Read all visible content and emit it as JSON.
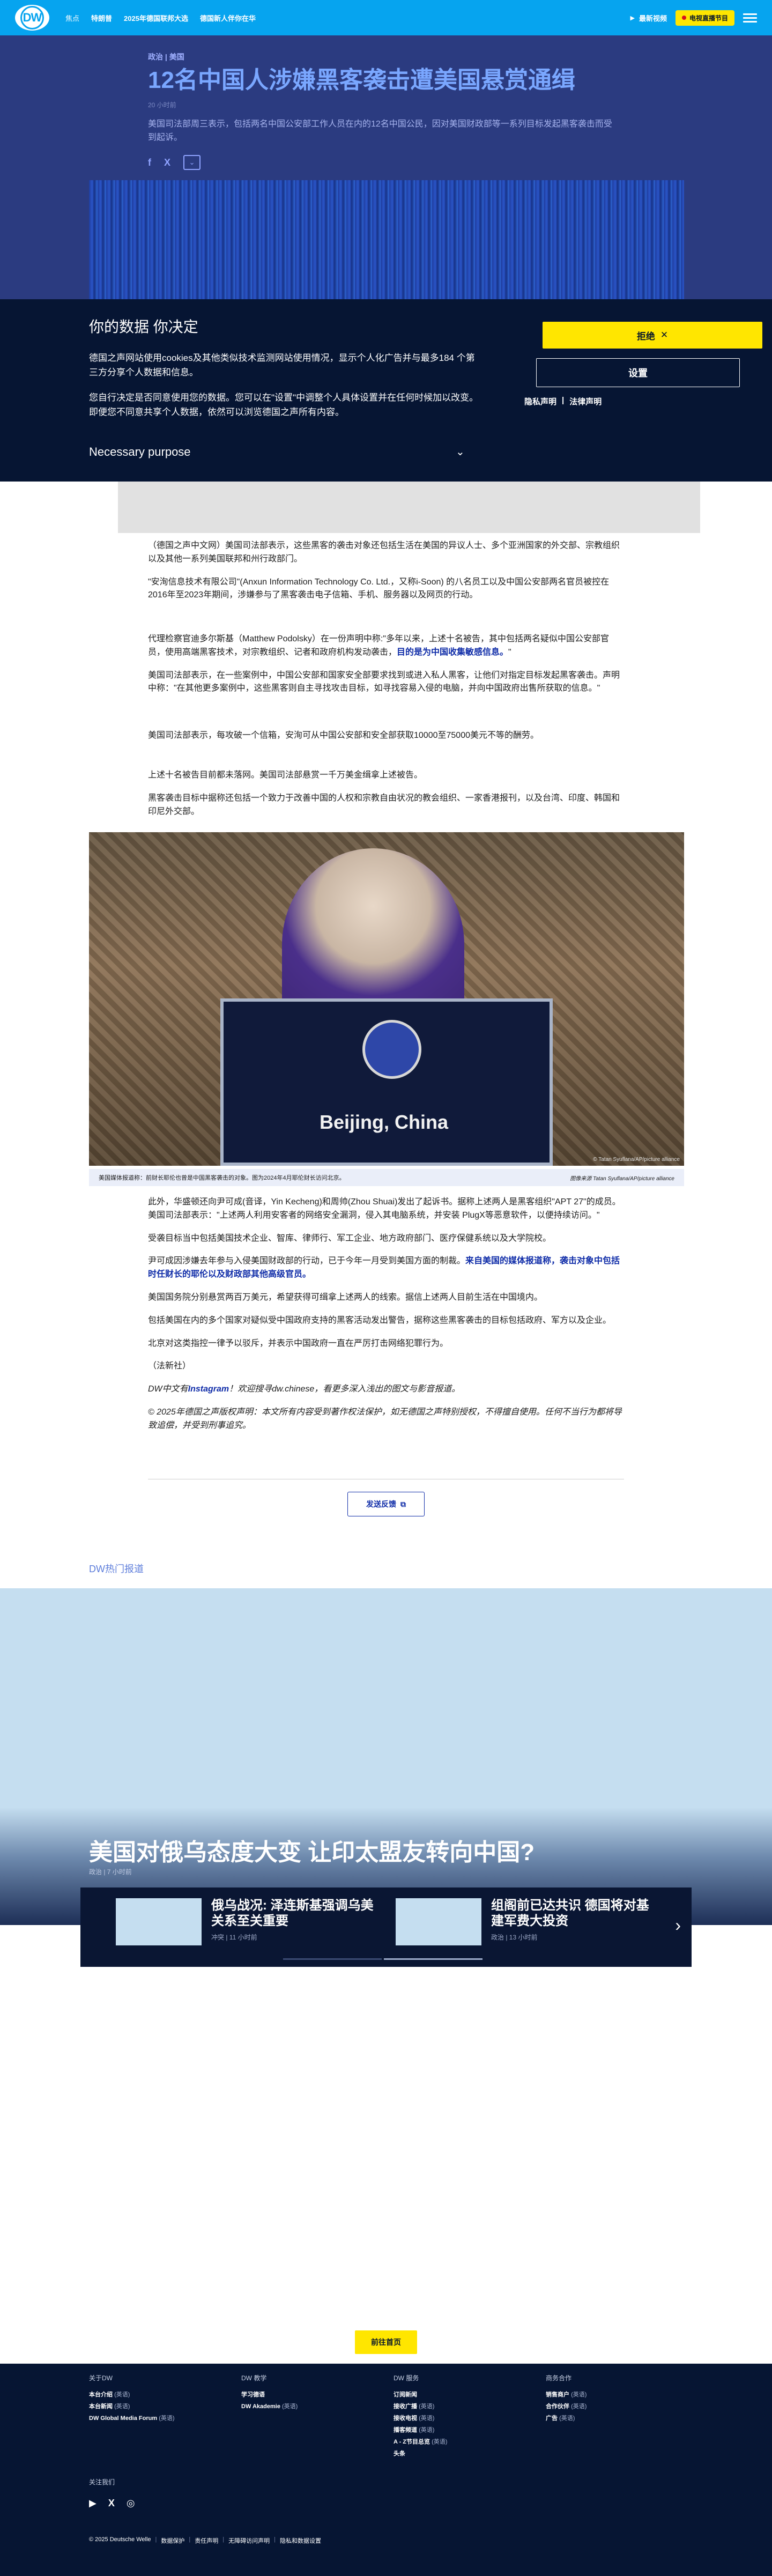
{
  "header": {
    "logo": "DW",
    "nav": [
      "焦点",
      "特朗普",
      "2025年德国联邦大选",
      "德国新人伴你在华"
    ],
    "latest_label": "最新视频",
    "live_label": "电视直播节目"
  },
  "article": {
    "breadcrumb": "政治 | 美国",
    "title": "12名中国人涉嫌黑客袭击遭美国悬赏通缉",
    "time_ago": "20 小时前",
    "teaser": "美国司法部周三表示，包括两名中国公安部工作人员在内的12名中国公民，因对美国财政部等一系列目标发起黑客袭击而受到起诉。",
    "share_icons": [
      "f",
      "X"
    ],
    "paragraphs_a": [
      "（德国之声中文网）美国司法部表示，这些黑客的袭击对象还包括生活在美国的异议人士、多个亚洲国家的外交部、宗教组织以及其他一系列美国联邦和州行政部门。",
      "\"安洵信息技术有限公司\"(Anxun Information Technology Co. Ltd.，又称i-Soon) 的八名员工以及中国公安部两名官员被控在2016年至2023年期间，涉嫌参与了黑客袭击电子信箱、手机、服务器以及网页的行动。"
    ],
    "paragraph_b_text": "代理检察官迪多尔斯基（Matthew Podolsky）在一份声明中称:\"多年以来，上述十名被告，其中包括两名疑似中国公安部官员，使用高端黑客技术，对宗教组织、记者和政府机构发动袭击，",
    "paragraph_b_link": "目的是为中国收集敏感信息。",
    "paragraph_b_end": "\"",
    "paragraph_b2": "美国司法部表示，在一些案例中，中国公安部和国家安全部要求找到或进入私人黑客，让他们对指定目标发起黑客袭击。声明中称：\"在其他更多案例中，这些黑客则自主寻找攻击目标，如寻找容易入侵的电脑，并向中国政府出售所获取的信息。\"",
    "paragraph_c": "美国司法部表示，每攻破一个信箱，安洵可从中国公安部和安全部获取10000至75000美元不等的酬劳。",
    "paragraphs_d": [
      "上述十名被告目前都未落网。美国司法部悬赏一千万美金缉拿上述被告。",
      "黑客袭击目标中据称还包括一个致力于改善中国的人权和宗教自由状况的教会组织、一家香港报刊，以及台湾、印度、韩国和印尼外交部。"
    ],
    "photo_plate": "Beijing, China",
    "photo_credit": "© Tatan Syuflana/AP/picture alliance",
    "caption": "美国媒体报道称：前财长耶伦也曾是中国黑客袭击的对象。图为2024年4月耶伦财长访问北京。",
    "caption_credit": "图像来源 Tatan Syuflana/AP/picture alliance",
    "paragraphs_e": [
      "此外，华盛顿还向尹可成(音译，Yin Kecheng)和周帅(Zhou Shuai)发出了起诉书。据称上述两人是黑客组织\"APT 27\"的成员。美国司法部表示：\"上述两人利用安客者的网络安全漏洞，侵入其电脑系统，并安装 PlugX等恶意软件，以便持续访问。\"",
      "受袭目标当中包括美国技术企业、智库、律师行、军工企业、地方政府部门、医疗保健系统以及大学院校。"
    ],
    "paragraph_f_text": "尹可成因涉嫌去年参与入侵美国财政部的行动，已于今年一月受到美国方面的制裁。",
    "paragraph_f_link": "来自美国的媒体报道称，袭击对象中包括时任财长的耶伦以及财政部其他高级官员。",
    "paragraphs_g": [
      "美国国务院分别悬赏两百万美元，希望获得可缉拿上述两人的线索。据信上述两人目前生活在中国境内。",
      "包括美国在内的多个国家对疑似受中国政府支持的黑客活动发出警告，据称这些黑客袭击的目标包括政府、军方以及企业。",
      "北京对这类指控一律予以驳斥，并表示中国政府一直在严厉打击网络犯罪行为。",
      "（法新社）"
    ],
    "instagram_pre": "DW中文有",
    "instagram_link": "Instagram",
    "instagram_post": "！欢迎搜寻dw.chinese，看更多深入浅出的图文与影音报道。",
    "copyright": "© 2025年德国之声版权声明：本文所有内容受到著作权法保护，如无德国之声特别授权，不得擅自使用。任何不当行为都将导致追偿，并受到刑事追究。",
    "feedback_label": "发送反馈"
  },
  "cookie": {
    "title": "你的数据 你决定",
    "text1": "德国之声网站使用cookies及其他类似技术监测网站使用情况，显示个人化广告并与最多184 个第三方分享个人数据和信息。",
    "text2": "您自行决定是否同意使用您的数据。您可以在\"设置\"中调整个人具体设置并在任何时候加以改变。即便您不同意共享个人数据，依然可以浏览德国之声所有内容。",
    "reject_label": "拒绝",
    "settings_label": "设置",
    "privacy_link": "隐私声明",
    "legal_link": "法律声明",
    "purpose_label": "Necessary purpose"
  },
  "hot": {
    "label": "DW热门报道",
    "title": "美国对俄乌态度大变 让印太盟友转向中国?",
    "meta": "政治 | 7 小时前",
    "cards": [
      {
        "title": "俄乌战况: 泽连斯基强调乌美关系至关重要",
        "meta": "冲突 | 11 小时前"
      },
      {
        "title": "组阁前已达共识 德国将对基建军费大投资",
        "meta": "政治 | 13 小时前"
      }
    ]
  },
  "cta_label": "前往首页",
  "footer": {
    "col1_title": "关于DW",
    "col1_links": [
      [
        "本台介绍",
        "(英语)"
      ],
      [
        "本台新闻",
        "(英语)"
      ],
      [
        "DW Global Media Forum",
        "(英语)"
      ]
    ],
    "col2_title": "DW 教学",
    "col2_links": [
      [
        "学习德语",
        ""
      ],
      [
        "DW Akademie",
        "(英语)"
      ]
    ],
    "col3_title": "DW 服务",
    "col3_links": [
      [
        "订阅新闻",
        ""
      ],
      [
        "接收广播",
        "(英语)"
      ],
      [
        "接收电视",
        "(英语)"
      ],
      [
        "播客频道",
        "(英语)"
      ],
      [
        "A - Z节目总览",
        "(英语)"
      ],
      [
        "头条",
        ""
      ]
    ],
    "col4_title": "商务合作",
    "col4_links": [
      [
        "销售商户",
        "(英语)"
      ],
      [
        "合作伙伴",
        "(英语)"
      ],
      [
        "广告",
        "(英语)"
      ]
    ],
    "follow_label": "关注我们",
    "social": [
      "▶",
      "X",
      "◎"
    ],
    "bottom": [
      "© 2025 Deutsche Welle",
      "数据保护",
      "责任声明",
      "无障碍访问声明",
      "隐私和数据设置"
    ]
  }
}
